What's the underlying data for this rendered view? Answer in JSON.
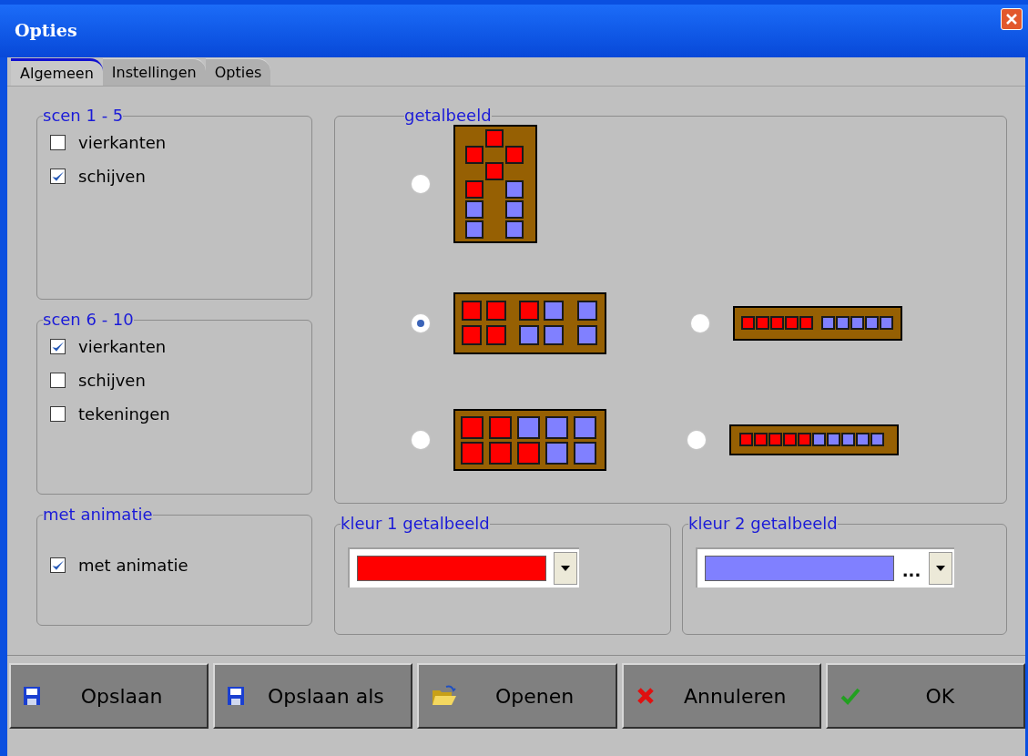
{
  "window": {
    "title": "Opties"
  },
  "tabs": [
    {
      "label": "Algemeen",
      "selected": true
    },
    {
      "label": "Instellingen",
      "selected": false
    },
    {
      "label": "Opties",
      "selected": false
    }
  ],
  "scen_1_5": {
    "title": "scen 1 - 5",
    "options": [
      {
        "label": "vierkanten",
        "checked": false
      },
      {
        "label": "schijven",
        "checked": true
      }
    ]
  },
  "scen_6_10": {
    "title": "scen 6 - 10",
    "options": [
      {
        "label": "vierkanten",
        "checked": true
      },
      {
        "label": "schijven",
        "checked": false
      },
      {
        "label": "tekeningen",
        "checked": false
      }
    ]
  },
  "animatie": {
    "title": "met animatie",
    "options": [
      {
        "label": "met animatie",
        "checked": true
      }
    ]
  },
  "getalbeeld": {
    "title": "getalbeeld",
    "options": [
      {
        "kind": "vertical",
        "selected": false
      },
      {
        "kind": "grouped",
        "selected": true
      },
      {
        "kind": "row-gap",
        "selected": false
      },
      {
        "kind": "two-row",
        "selected": false
      },
      {
        "kind": "row",
        "selected": false
      }
    ]
  },
  "kleur_1": {
    "title": "kleur 1 getalbeeld",
    "color": "#ff0000"
  },
  "kleur_2": {
    "title": "kleur 2 getalbeeld",
    "color": "#8080ff",
    "suffix": "..."
  },
  "buttons": [
    {
      "kind": "save",
      "label": "Opslaan"
    },
    {
      "kind": "save",
      "label": "Opslaan als"
    },
    {
      "kind": "open",
      "label": "Openen"
    },
    {
      "kind": "cancel",
      "label": "Annuleren"
    },
    {
      "kind": "ok",
      "label": "OK"
    }
  ]
}
